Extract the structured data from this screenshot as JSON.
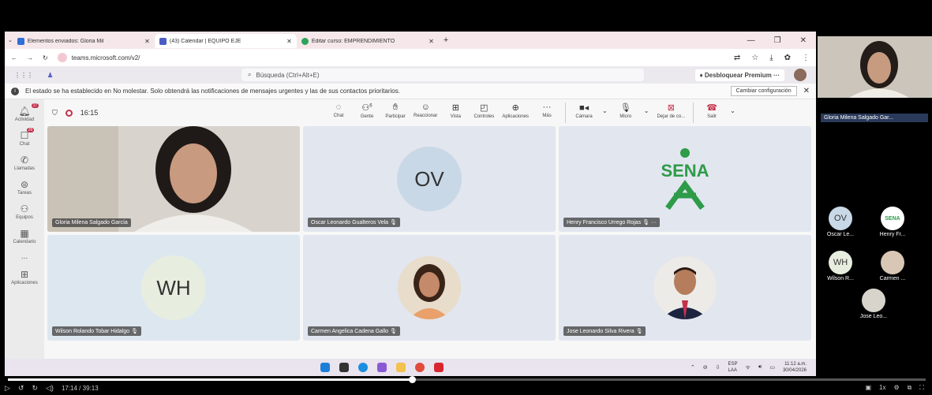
{
  "browser": {
    "tabs": [
      {
        "title": "Elementos enviados: Gloria Mil",
        "color": "#2f6fd6"
      },
      {
        "title": "(43) Calendar | EQUIPO EJE",
        "color": "#4b5cc4"
      },
      {
        "title": "Editar curso: EMPRENDIMIENTO",
        "color": "#2aa55b"
      }
    ],
    "url": "teams.microsoft.com/v2/"
  },
  "teams": {
    "search_placeholder": "Búsqueda (Ctrl+Alt+E)",
    "premium_label": "Desbloquear Premium",
    "notice_text": "El estado se ha establecido en No molestar. Solo obtendrá las notificaciones de mensajes urgentes y las de sus contactos prioritarios.",
    "change_config": "Cambiar configuración"
  },
  "rail": [
    {
      "label": "Actividad",
      "icon": "bell-icon",
      "badge": "17"
    },
    {
      "label": "Chat",
      "icon": "chat-icon",
      "badge": "26"
    },
    {
      "label": "Llamadas",
      "icon": "phone-icon",
      "badge": ""
    },
    {
      "label": "Tareas",
      "icon": "tasks-icon",
      "badge": ""
    },
    {
      "label": "Equipos",
      "icon": "teams-icon",
      "badge": ""
    },
    {
      "label": "Calendario",
      "icon": "calendar-icon",
      "badge": ""
    },
    {
      "label": "...",
      "icon": "more-icon",
      "badge": ""
    },
    {
      "label": "Aplicaciones",
      "icon": "apps-icon",
      "badge": ""
    }
  ],
  "meeting": {
    "time": "16:15",
    "people_count": "6",
    "tools": {
      "chat": "Chat",
      "people": "Gente",
      "raise": "Participar",
      "react": "Reaccionar",
      "view": "Vista",
      "controls": "Controles",
      "apps": "Aplicaciones",
      "more": "Más",
      "camera": "Cámara",
      "mic": "Micro",
      "share": "Dejar de co...",
      "leave": "Salir"
    },
    "tiles": [
      {
        "name": "Gloria Milena Salgado García",
        "initials": ""
      },
      {
        "name": "Oscar Leonardo Gualteros Vela",
        "initials": "OV"
      },
      {
        "name": "Henry Francisco Urrego Rojas",
        "initials": "SENA"
      },
      {
        "name": "Wilson Rolando Tobar Hidalgo",
        "initials": "WH"
      },
      {
        "name": "Carmen Angelica Cadena Gallo",
        "initials": ""
      },
      {
        "name": "Jose Leonardo Silva Rivera",
        "initials": ""
      }
    ]
  },
  "taskbar": {
    "lang1": "ESP",
    "lang2": "LAA",
    "time": "11:12 a.m.",
    "date": "30/04/2026"
  },
  "side_panel": {
    "self_name": "Gloria Milena Salgado Gar...",
    "participants": [
      {
        "initials": "OV",
        "label": "Oscar Le..."
      },
      {
        "initials": "SENA",
        "label": "Henry Fr..."
      },
      {
        "initials": "WH",
        "label": "Wilson R..."
      },
      {
        "initials": "",
        "label": "Carmen ..."
      },
      {
        "initials": "",
        "label": "Jose Leo..."
      }
    ]
  },
  "player": {
    "timecode": "17:14 / 39:13",
    "speed": "1x",
    "progress": 0.44
  }
}
